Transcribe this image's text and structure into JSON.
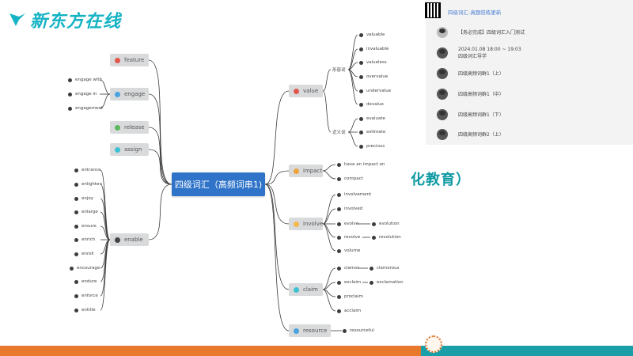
{
  "logo": {
    "text": "新东方在线"
  },
  "watermark": "化教育）",
  "center": {
    "label": "四级词汇（高频词串1)"
  },
  "branches": {
    "feature": {
      "num": "6",
      "label": "feature",
      "color": "#e2574c"
    },
    "engage": {
      "num": "7",
      "label": "engage",
      "color": "#4aa3df",
      "leaves": [
        {
          "num": "1",
          "text": "engage with"
        },
        {
          "num": "2",
          "text": "engage in"
        },
        {
          "num": "3",
          "text": "engagement"
        }
      ]
    },
    "release": {
      "num": "8",
      "label": "release",
      "color": "#5cb85c"
    },
    "assign": {
      "num": "9",
      "label": "assign",
      "color": "#3ec1d3"
    },
    "enable": {
      "num": "",
      "label": "enable",
      "color": "#444444",
      "leaves": [
        {
          "num": "1",
          "text": "entrance"
        },
        {
          "num": "2",
          "text": "enlighten"
        },
        {
          "num": "3",
          "text": "enjoy"
        },
        {
          "num": "4",
          "text": "enlarge"
        },
        {
          "num": "5",
          "text": "ensure"
        },
        {
          "num": "6",
          "text": "enrich"
        },
        {
          "num": "7",
          "text": "enroll"
        },
        {
          "num": "8",
          "text": "encourage"
        },
        {
          "num": "9",
          "text": "endure"
        },
        {
          "num": "",
          "text": "enforce"
        },
        {
          "num": "",
          "text": "entitle"
        }
      ]
    },
    "value": {
      "num": "1",
      "label": "value",
      "color": "#e2574c",
      "group1": {
        "title": "形容词",
        "leaves": [
          {
            "num": "1",
            "text": "valuable"
          },
          {
            "num": "2",
            "text": "invaluable"
          },
          {
            "num": "3",
            "text": "valueless"
          },
          {
            "num": "4",
            "text": "overvalue"
          },
          {
            "num": "5",
            "text": "undervalue"
          },
          {
            "num": "6",
            "text": "devalue"
          }
        ]
      },
      "group2": {
        "title": "近义词",
        "leaves": [
          {
            "num": "1",
            "text": "evaluate"
          },
          {
            "num": "2",
            "text": "estimate"
          },
          {
            "num": "3",
            "text": "precious"
          }
        ]
      }
    },
    "impact": {
      "num": "2",
      "label": "impact",
      "color": "#f0a23b",
      "leaves": [
        {
          "num": "1",
          "text": "have an impact on"
        },
        {
          "num": "2",
          "text": "compact"
        }
      ]
    },
    "involve": {
      "num": "3",
      "label": "involve",
      "color": "#f5b94a",
      "leaves": [
        {
          "num": "1",
          "text": "involvement"
        },
        {
          "num": "2",
          "text": "involved"
        },
        {
          "num": "3",
          "text": "evolve"
        },
        {
          "num": "4",
          "text": "revolve"
        },
        {
          "num": "5",
          "text": "volume"
        }
      ],
      "sub": [
        {
          "num": "4",
          "text": "evolution"
        },
        {
          "num": "4",
          "text": "revolution"
        }
      ]
    },
    "claim": {
      "num": "4",
      "label": "claim",
      "color": "#3ec1d3",
      "leaves": [
        {
          "num": "1",
          "text": "clamor"
        },
        {
          "num": "2",
          "text": "exclaim"
        },
        {
          "num": "3",
          "text": "proclaim"
        },
        {
          "num": "4",
          "text": "acclaim"
        }
      ],
      "sub": [
        {
          "num": "4",
          "text": "clamorous"
        },
        {
          "num": "4",
          "text": "exclamation"
        }
      ]
    },
    "resource": {
      "num": "5",
      "label": "resource",
      "color": "#4aa3df",
      "leaves": [
        {
          "num": "1",
          "text": "resourceful"
        }
      ]
    }
  },
  "panel": {
    "title": "四级词汇-真题陪练更新",
    "items": [
      {
        "line1": "【务必完成】四级词汇入门测试",
        "line2": ""
      },
      {
        "line1": "2024.01.08 18:00 ~ 19:03",
        "line2": "四级词汇导学"
      },
      {
        "line1": "四级高频词群1（上）",
        "line2": ""
      },
      {
        "line1": "四级高频词群1（中）",
        "line2": ""
      },
      {
        "line1": "四级高频词群1（下）",
        "line2": ""
      },
      {
        "line1": "四级高频词群2（上）",
        "line2": ""
      }
    ]
  }
}
